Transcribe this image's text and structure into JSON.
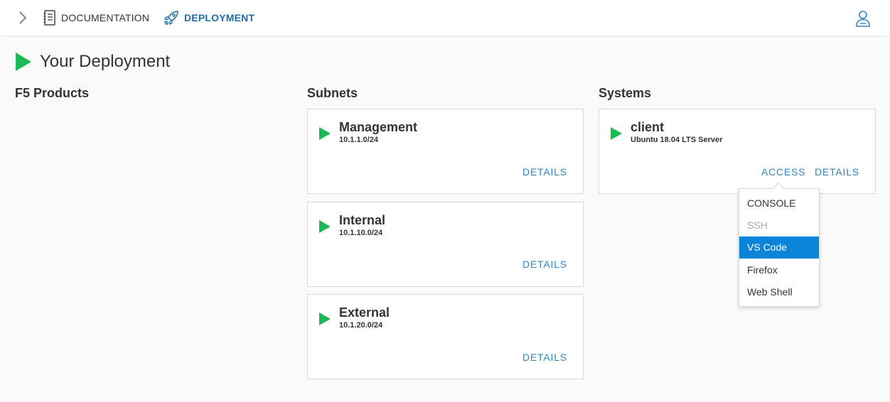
{
  "nav": {
    "documentation_label": "DOCUMENTATION",
    "deployment_label": "DEPLOYMENT"
  },
  "page": {
    "title": "Your Deployment"
  },
  "columns": {
    "products": "F5 Products",
    "subnets": "Subnets",
    "systems": "Systems"
  },
  "subnets": [
    {
      "name": "Management",
      "cidr": "10.1.1.0/24",
      "details_label": "DETAILS"
    },
    {
      "name": "Internal",
      "cidr": "10.1.10.0/24",
      "details_label": "DETAILS"
    },
    {
      "name": "External",
      "cidr": "10.1.20.0/24",
      "details_label": "DETAILS"
    }
  ],
  "systems": [
    {
      "name": "client",
      "os": "Ubuntu 18.04 LTS Server",
      "access_label": "ACCESS",
      "details_label": "DETAILS"
    }
  ],
  "access_menu": {
    "items": [
      {
        "label": "CONSOLE",
        "state": "normal"
      },
      {
        "label": "SSH",
        "state": "disabled"
      },
      {
        "label": "VS Code",
        "state": "highlighted"
      },
      {
        "label": "Firefox",
        "state": "normal"
      },
      {
        "label": "Web Shell",
        "state": "normal"
      }
    ]
  },
  "colors": {
    "accent_blue": "#2f86c5",
    "nav_active": "#1f6fa8",
    "status_green": "#1db954",
    "menu_highlight": "#0a84d8"
  }
}
